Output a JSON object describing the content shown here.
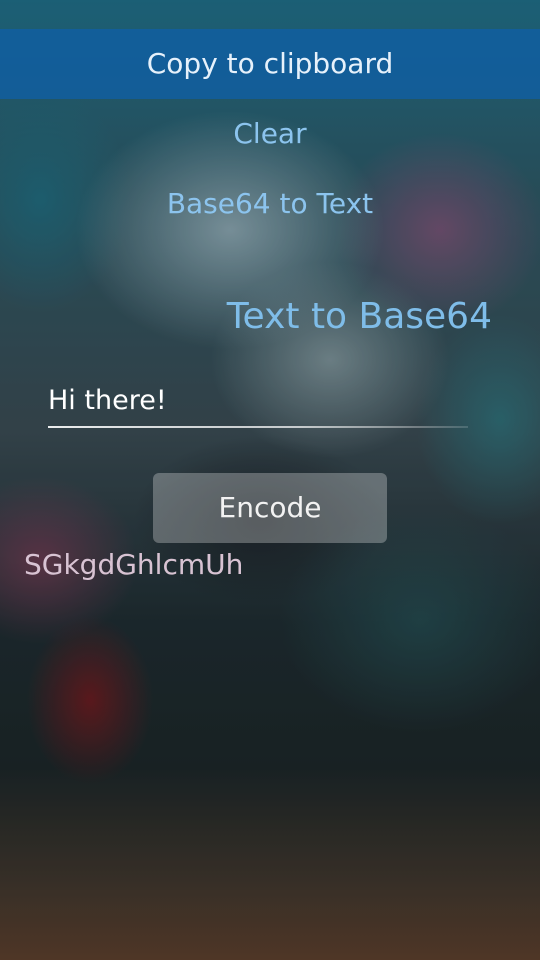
{
  "pulley_menu": {
    "items": [
      {
        "label": "Copy to clipboard",
        "highlighted": true
      },
      {
        "label": "Clear",
        "highlighted": false
      },
      {
        "label": "Base64 to Text",
        "highlighted": false
      }
    ]
  },
  "page": {
    "header_title": "Text to Base64"
  },
  "input": {
    "value": "Hi there!"
  },
  "encode_button": {
    "label": "Encode"
  },
  "result": {
    "text": "SGkgdGhlcmUh"
  },
  "colors": {
    "highlight_bar": "#0f5fa5",
    "menu_text": "#8cc4ee",
    "header_text": "#7fbde9",
    "result_text": "#d8c3d3"
  }
}
